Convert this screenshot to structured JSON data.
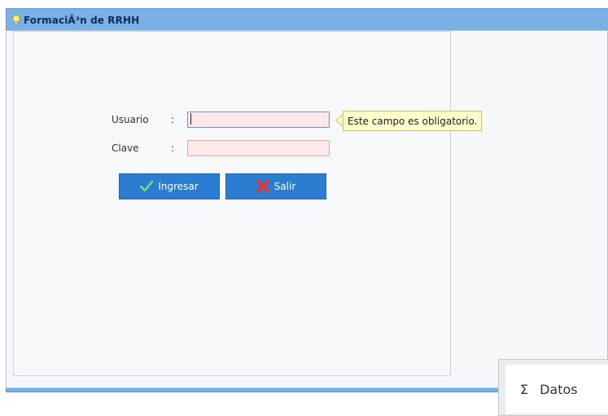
{
  "window": {
    "title": "FormaciÃ³n de RRHH"
  },
  "login_form": {
    "usuario_label": "Usuario",
    "clave_label": "Clave",
    "colon": ":",
    "usuario_value": "",
    "clave_value": "",
    "validation_tooltip": "Este campo es obligatorio.",
    "ingresar_label": "Ingresar",
    "salir_label": "Salir"
  },
  "datos_popup": {
    "label": "Datos",
    "icon": "sigma-icon"
  },
  "colors": {
    "header": "#79b1e6",
    "button": "#2a7dd0",
    "input_invalid_bg": "#fde9e9",
    "tooltip_bg": "#ffffcc"
  }
}
